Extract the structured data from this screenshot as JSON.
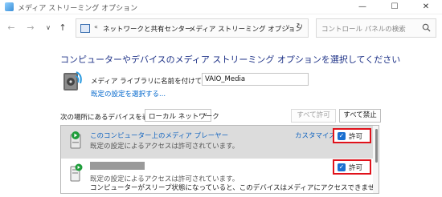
{
  "window": {
    "title": "メディア ストリーミング オプション",
    "controls": {
      "minimize": "—",
      "maximize": "☐",
      "close": "✕"
    }
  },
  "nav": {
    "back_icon": "←",
    "forward_icon": "→",
    "recent_icon": "∨",
    "up_icon": "↑"
  },
  "address": {
    "overflow": "«",
    "crumbs": [
      "ネットワークと共有センター",
      "メディア ストリーミング オプション"
    ],
    "separator": "›",
    "dropdown_icon": "∨",
    "refresh_icon": "↻"
  },
  "search": {
    "placeholder": "コントロール パネルの検索"
  },
  "main": {
    "heading": "コンピューターやデバイスのメディア ストリーミング オプションを選択してください",
    "library_label": "メディア ライブラリに名前を付けてください:",
    "library_name": "VAIO_Media",
    "default_link": "既定の設定を選択する...",
    "show_devices_label": "次の場所にあるデバイスを表示:",
    "network_select": "ローカル ネットワーク",
    "allow_all": "すべて許可",
    "block_all": "すべて禁止"
  },
  "devices": [
    {
      "name": "このコンピューター上のメディア プレーヤー",
      "status": "既定の設定によるアクセスは許可されています。",
      "customize": "カスタマイズ...",
      "allow_label": "許可",
      "allowed": true
    },
    {
      "name": "",
      "status": "既定の設定によるアクセスは許可されています。",
      "note": "コンピューターがスリープ状態になっていると、このデバイスはメディアにアクセスできません。",
      "allow_label": "許可",
      "allowed": true
    }
  ],
  "colors": {
    "heading": "#1e3287",
    "link": "#1566c0",
    "highlight": "#e0121b",
    "checkbox": "#1a6fd0",
    "selected_row": "#dcdcdc"
  }
}
